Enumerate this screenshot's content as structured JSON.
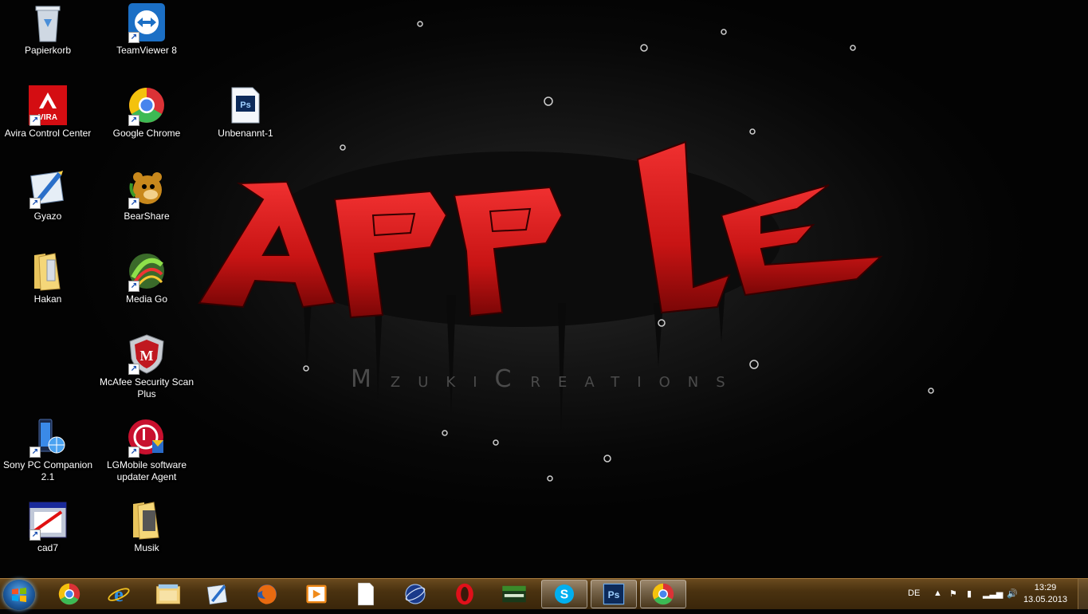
{
  "wallpaper": {
    "title_text": "APPLE",
    "brand": {
      "m": "M",
      "zuki": "ZUKI",
      "c": "C",
      "reations": "REATIONS"
    }
  },
  "desktop_icons": [
    {
      "label": "Papierkorb",
      "icon": "recycle-bin-icon"
    },
    {
      "label": "TeamViewer 8",
      "icon": "teamviewer-icon"
    },
    {
      "label": "Avira Control Center",
      "icon": "avira-icon",
      "badge": "VIRA"
    },
    {
      "label": "Google Chrome",
      "icon": "chrome-icon"
    },
    {
      "label": "Unbenannt-1",
      "icon": "photoshop-file-icon",
      "badge": "Ps"
    },
    {
      "label": "Gyazo",
      "icon": "gyazo-icon"
    },
    {
      "label": "BearShare",
      "icon": "bearshare-icon"
    },
    {
      "label": "Hakan",
      "icon": "folder-icon"
    },
    {
      "label": "Media Go",
      "icon": "media-go-icon"
    },
    {
      "label": "McAfee Security Scan Plus",
      "icon": "mcafee-icon",
      "badge": "M"
    },
    {
      "label": "Sony PC Companion 2.1",
      "icon": "sony-pc-companion-icon"
    },
    {
      "label": "LGMobile software updater Agent",
      "icon": "lg-mobile-icon"
    },
    {
      "label": "cad7",
      "icon": "cad7-icon"
    },
    {
      "label": "Musik",
      "icon": "music-folder-icon"
    }
  ],
  "taskbar": {
    "pinned": [
      {
        "name": "chrome",
        "icon": "chrome-icon"
      },
      {
        "name": "internet-explorer",
        "icon": "internet-explorer-icon"
      },
      {
        "name": "explorer",
        "icon": "file-explorer-icon"
      },
      {
        "name": "gyazo",
        "icon": "gyazo-icon"
      },
      {
        "name": "firefox",
        "icon": "firefox-icon"
      },
      {
        "name": "media-player",
        "icon": "media-player-icon"
      },
      {
        "name": "document",
        "icon": "blank-document-icon"
      },
      {
        "name": "globe",
        "icon": "globe-icon"
      },
      {
        "name": "opera",
        "icon": "opera-icon"
      },
      {
        "name": "game",
        "icon": "game-icon"
      },
      {
        "name": "skype",
        "icon": "skype-icon",
        "badge": "S"
      },
      {
        "name": "photoshop",
        "icon": "photoshop-icon",
        "badge": "Ps"
      },
      {
        "name": "chrome-running",
        "icon": "chrome-icon"
      }
    ],
    "tray": {
      "language": "DE",
      "time": "13:29",
      "date": "13.05.2013"
    }
  },
  "colors": {
    "taskbar": "#4a3210",
    "graffiti_red": "#d21818",
    "start_orb": "#1d5a9e"
  }
}
